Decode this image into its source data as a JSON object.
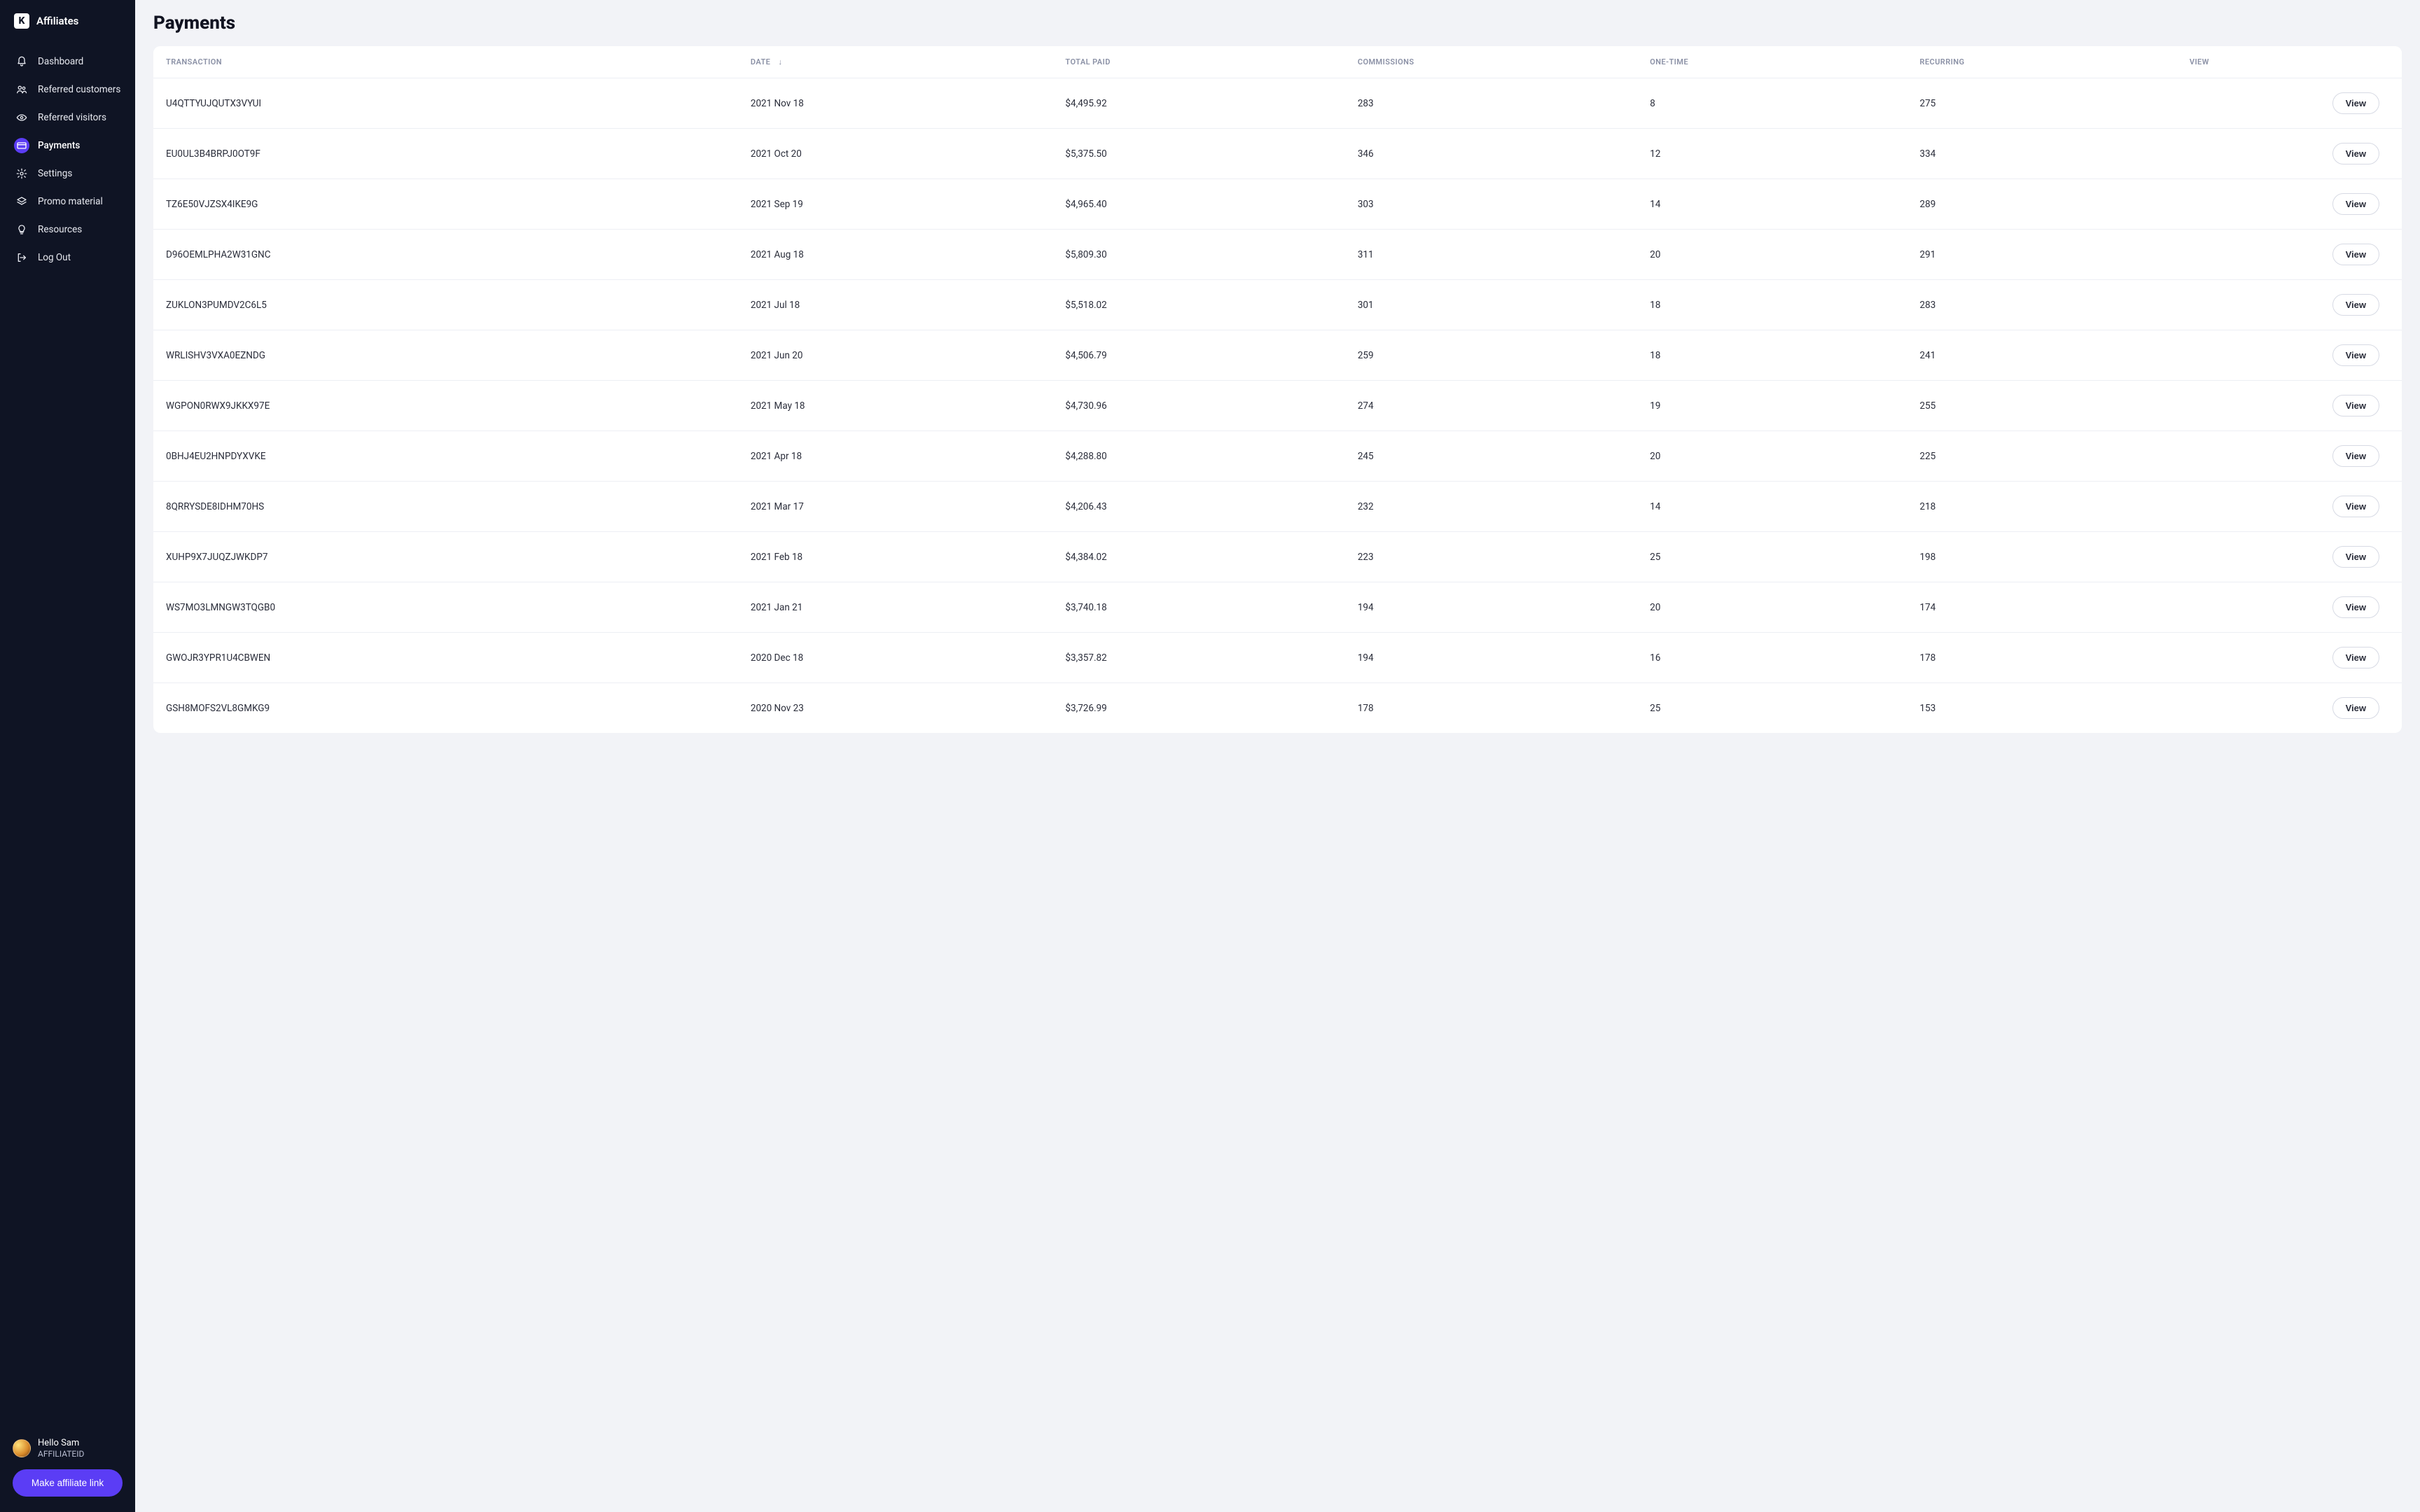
{
  "brand": {
    "title": "Affiliates",
    "logo_letter": "K"
  },
  "nav": {
    "items": [
      {
        "label": "Dashboard",
        "icon": "bell"
      },
      {
        "label": "Referred customers",
        "icon": "users"
      },
      {
        "label": "Referred visitors",
        "icon": "eye"
      },
      {
        "label": "Payments",
        "icon": "card",
        "active": true
      },
      {
        "label": "Settings",
        "icon": "gear"
      },
      {
        "label": "Promo material",
        "icon": "layers"
      },
      {
        "label": "Resources",
        "icon": "bulb"
      },
      {
        "label": "Log Out",
        "icon": "logout"
      }
    ]
  },
  "user": {
    "hello": "Hello Sam",
    "id": "AFFILIATEID"
  },
  "cta": {
    "make_link": "Make affiliate link"
  },
  "page": {
    "title": "Payments"
  },
  "table": {
    "columns": {
      "transaction": "TRANSACTION",
      "date": "DATE",
      "total_paid": "TOTAL PAID",
      "commissions": "COMMISSIONS",
      "one_time": "ONE-TIME",
      "recurring": "RECURRING",
      "view": "VIEW"
    },
    "sort_arrow": "↓",
    "view_label": "View",
    "rows": [
      {
        "txn": "U4QTTYUJQUTX3VYUI",
        "date": "2021 Nov 18",
        "total": "$4,495.92",
        "comm": "283",
        "one": "8",
        "rec": "275"
      },
      {
        "txn": "EU0UL3B4BRPJ0OT9F",
        "date": "2021 Oct 20",
        "total": "$5,375.50",
        "comm": "346",
        "one": "12",
        "rec": "334"
      },
      {
        "txn": "TZ6E50VJZSX4IKE9G",
        "date": "2021 Sep 19",
        "total": "$4,965.40",
        "comm": "303",
        "one": "14",
        "rec": "289"
      },
      {
        "txn": "D96OEMLPHA2W31GNC",
        "date": "2021 Aug 18",
        "total": "$5,809.30",
        "comm": "311",
        "one": "20",
        "rec": "291"
      },
      {
        "txn": "ZUKLON3PUMDV2C6L5",
        "date": "2021 Jul 18",
        "total": "$5,518.02",
        "comm": "301",
        "one": "18",
        "rec": "283"
      },
      {
        "txn": "WRLISHV3VXA0EZNDG",
        "date": "2021 Jun 20",
        "total": "$4,506.79",
        "comm": "259",
        "one": "18",
        "rec": "241"
      },
      {
        "txn": "WGPON0RWX9JKKX97E",
        "date": "2021 May 18",
        "total": "$4,730.96",
        "comm": "274",
        "one": "19",
        "rec": "255"
      },
      {
        "txn": "0BHJ4EU2HNPDYXVKE",
        "date": "2021 Apr 18",
        "total": "$4,288.80",
        "comm": "245",
        "one": "20",
        "rec": "225"
      },
      {
        "txn": "8QRRYSDE8IDHM70HS",
        "date": "2021 Mar 17",
        "total": "$4,206.43",
        "comm": "232",
        "one": "14",
        "rec": "218"
      },
      {
        "txn": "XUHP9X7JUQZJWKDP7",
        "date": "2021 Feb 18",
        "total": "$4,384.02",
        "comm": "223",
        "one": "25",
        "rec": "198"
      },
      {
        "txn": "WS7MO3LMNGW3TQGB0",
        "date": "2021 Jan 21",
        "total": "$3,740.18",
        "comm": "194",
        "one": "20",
        "rec": "174"
      },
      {
        "txn": "GWOJR3YPR1U4CBWEN",
        "date": "2020 Dec 18",
        "total": "$3,357.82",
        "comm": "194",
        "one": "16",
        "rec": "178"
      },
      {
        "txn": "GSH8MOFS2VL8GMKG9",
        "date": "2020 Nov 23",
        "total": "$3,726.99",
        "comm": "178",
        "one": "25",
        "rec": "153"
      }
    ]
  }
}
